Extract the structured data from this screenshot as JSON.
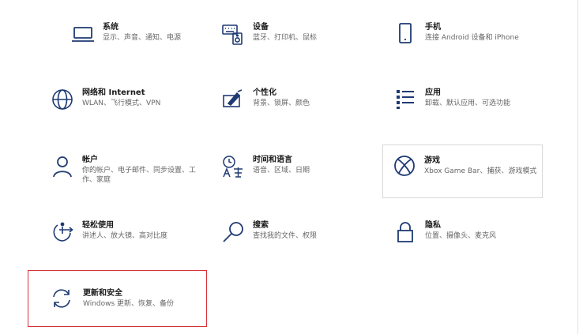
{
  "settings_tiles": [
    {
      "title": "系统",
      "desc": "显示、声音、通知、电源",
      "icon": "laptop-icon"
    },
    {
      "title": "设备",
      "desc": "蓝牙、打印机、鼠标",
      "icon": "keyboard-speaker-icon"
    },
    {
      "title": "手机",
      "desc": "连接 Android 设备和 iPhone",
      "icon": "phone-icon"
    },
    {
      "title": "网络和 Internet",
      "desc": "WLAN、飞行模式、VPN",
      "icon": "globe-icon"
    },
    {
      "title": "个性化",
      "desc": "背景、锁屏、颜色",
      "icon": "paint-brush-icon"
    },
    {
      "title": "应用",
      "desc": "卸载、默认应用、可选功能",
      "icon": "apps-list-icon"
    },
    {
      "title": "帐户",
      "desc": "你的帐户、电子邮件、同步设置、工作、家庭",
      "icon": "person-icon"
    },
    {
      "title": "时间和语言",
      "desc": "语音、区域、日期",
      "icon": "time-language-icon"
    },
    {
      "title": "游戏",
      "desc": "Xbox Game Bar、捕获、游戏模式",
      "icon": "xbox-icon"
    },
    {
      "title": "轻松使用",
      "desc": "讲述人、放大镜、高对比度",
      "icon": "ease-of-access-icon"
    },
    {
      "title": "搜索",
      "desc": "查找我的文件、权限",
      "icon": "search-icon"
    },
    {
      "title": "隐私",
      "desc": "位置、摄像头、麦克风",
      "icon": "lock-icon"
    },
    {
      "title": "更新和安全",
      "desc": "Windows 更新、恢复、备份",
      "icon": "sync-arrows-icon"
    }
  ],
  "colors": {
    "icon": "#1f3a73",
    "selection_border": "#d9303a",
    "hover_border": "#d8d8d8"
  },
  "state": {
    "hovered_tile": "游戏",
    "selected_tile": "更新和安全"
  }
}
